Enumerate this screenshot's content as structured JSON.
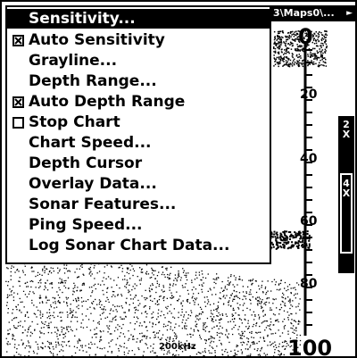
{
  "path_bar": {
    "text": "3\\Maps0\\...",
    "arrow": "►"
  },
  "menu": {
    "items": [
      {
        "label": "Sensitivity...",
        "selected": true,
        "checkbox": null
      },
      {
        "label": "Auto Sensitivity",
        "selected": false,
        "checkbox": "checked"
      },
      {
        "label": "Grayline...",
        "selected": false,
        "checkbox": null
      },
      {
        "label": "Depth Range...",
        "selected": false,
        "checkbox": null
      },
      {
        "label": "Auto Depth Range",
        "selected": false,
        "checkbox": "checked"
      },
      {
        "label": "Stop Chart",
        "selected": false,
        "checkbox": "unchecked"
      },
      {
        "label": "Chart Speed...",
        "selected": false,
        "checkbox": null
      },
      {
        "label": "Depth Cursor",
        "selected": false,
        "checkbox": null
      },
      {
        "label": "Overlay Data...",
        "selected": false,
        "checkbox": null
      },
      {
        "label": "Sonar Features...",
        "selected": false,
        "checkbox": null
      },
      {
        "label": "Ping Speed...",
        "selected": false,
        "checkbox": null
      },
      {
        "label": "Log Sonar Chart Data...",
        "selected": false,
        "checkbox": null
      }
    ]
  },
  "sonar": {
    "depth_labels": {
      "d0": "0",
      "d20": "20",
      "d40": "40",
      "d60": "60",
      "d80": "80",
      "d100": "100"
    },
    "frequency": "200kHz"
  },
  "zoom": {
    "label_2x": "2\nX",
    "label_4x": "4\nX"
  },
  "colors": {
    "background": "#ffffff",
    "foreground": "#000000",
    "selection": "#000000"
  }
}
